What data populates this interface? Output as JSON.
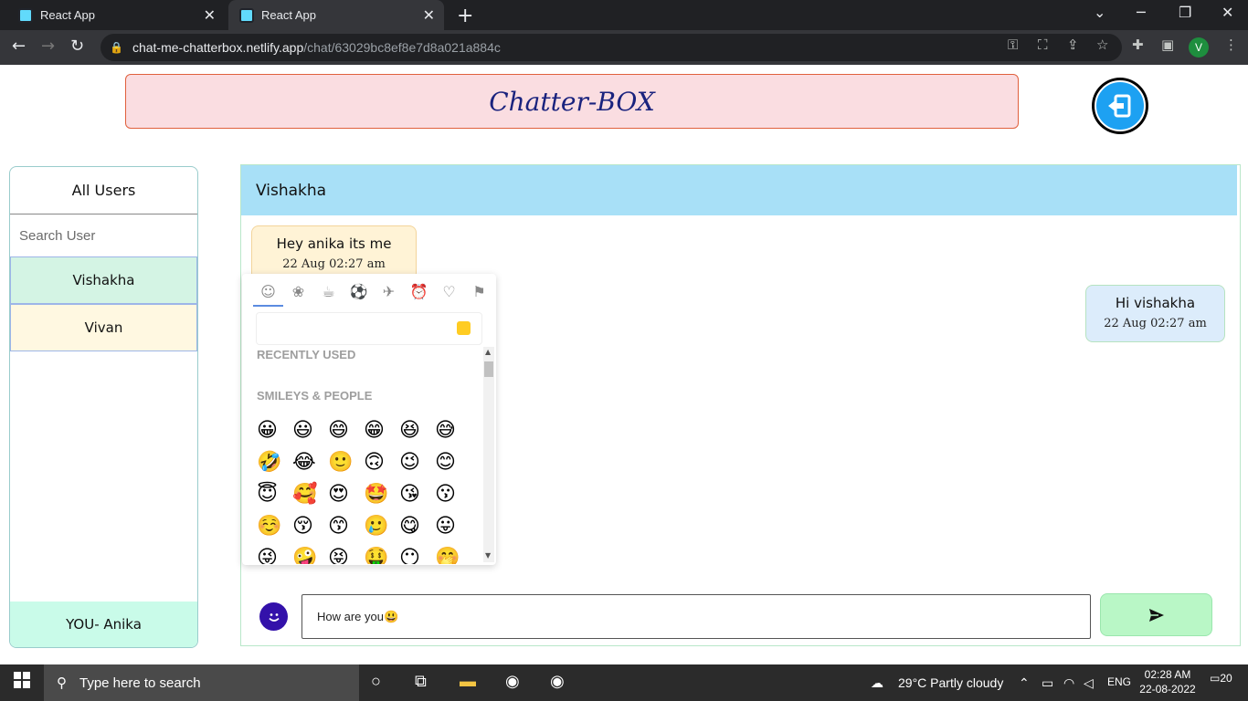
{
  "browser": {
    "tabs": [
      {
        "title": "React App",
        "active": false
      },
      {
        "title": "React App",
        "active": true
      }
    ],
    "url_host": "chat-me-chatterbox.netlify.app",
    "url_path": "/chat/63029bc8ef8e7d8a021a884c",
    "profile_initial": "V"
  },
  "app": {
    "title": "Chatter-BOX",
    "sidebar": {
      "title": "All Users",
      "search_placeholder": "Search User",
      "users": [
        "Vishakha",
        "Vivan"
      ],
      "current_user": "YOU- Anika"
    },
    "chat": {
      "contact": "Vishakha",
      "messages": [
        {
          "direction": "in",
          "text": "Hey anika its me",
          "time": "22 Aug 02:27 am"
        },
        {
          "direction": "out",
          "text": "Hi vishakha",
          "time": "22 Aug 02:27 am"
        }
      ],
      "input_value": "How are you😃"
    },
    "emoji_picker": {
      "categories": [
        "people",
        "nature",
        "food",
        "activity",
        "travel",
        "objects",
        "symbols",
        "flags"
      ],
      "sections": [
        "RECENTLY USED",
        "SMILEYS & PEOPLE"
      ],
      "emojis": [
        "😀",
        "😃",
        "😄",
        "😁",
        "😆",
        "😅",
        "🤣",
        "😂",
        "🙂",
        "🙃",
        "😉",
        "😊",
        "😇",
        "🥰",
        "😍",
        "🤩",
        "😘",
        "😗",
        "☺️",
        "😚",
        "😙",
        "🥲",
        "😋",
        "😛",
        "😜",
        "🤪",
        "😝",
        "🤑",
        "😶",
        "🤭"
      ]
    }
  },
  "taskbar": {
    "search_text": "Type here to search",
    "weather": "29°C  Partly cloudy",
    "lang": "ENG",
    "time": "02:28 AM",
    "date": "22-08-2022",
    "notifications": "20"
  }
}
